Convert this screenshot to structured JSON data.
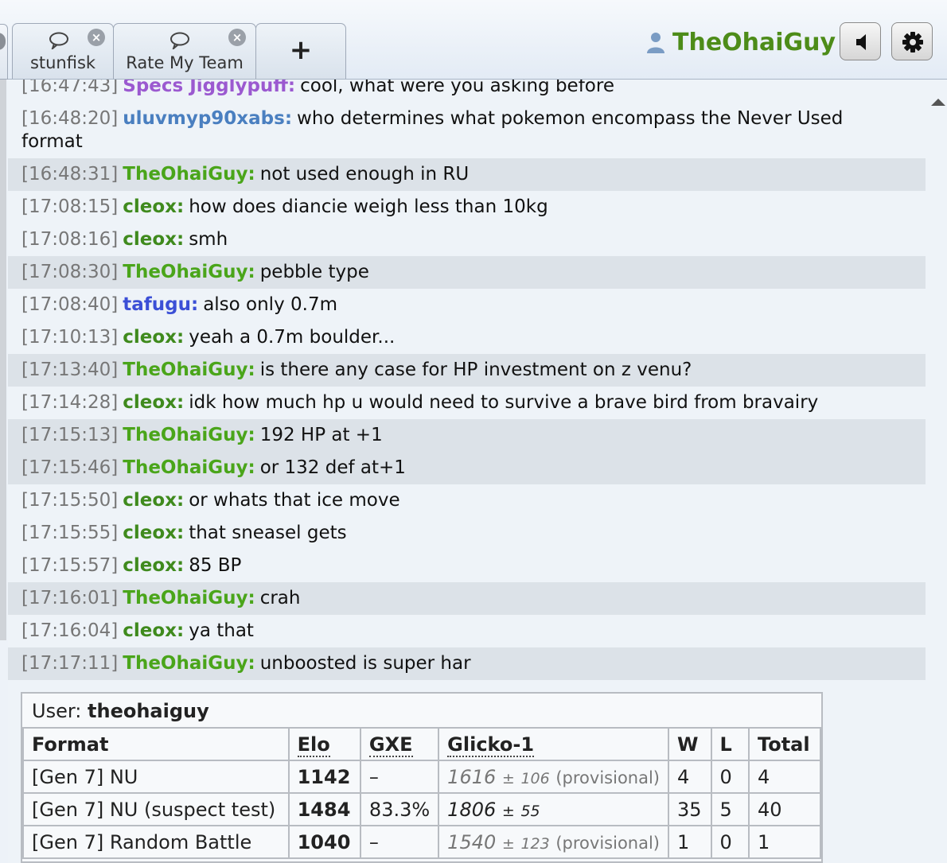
{
  "header": {
    "tabs": [
      {
        "label": "stunfisk"
      },
      {
        "label": "Rate My Team"
      }
    ],
    "add_label": "+",
    "username": "TheOhaiGuy",
    "colors": {
      "username": "#4d8c19"
    }
  },
  "chat": {
    "messages": [
      {
        "time": "[16:47:43]",
        "user": "Specs Jigglypuff:",
        "text": "cool, what were you asking before",
        "color": "#9b59d0",
        "hl": false
      },
      {
        "time": "[16:48:20]",
        "user": "uluvmyp90xabs:",
        "text": "who determines what pokemon encompass the Never Used format",
        "color": "#4a7fc0",
        "hl": false
      },
      {
        "time": "[16:48:31]",
        "user": "TheOhaiGuy:",
        "text": "not used enough in RU",
        "color": "#4aa51a",
        "hl": true
      },
      {
        "time": "[17:08:15]",
        "user": "cleox:",
        "text": "how does diancie weigh less than 10kg",
        "color": "#3f8a1d",
        "hl": false
      },
      {
        "time": "[17:08:16]",
        "user": "cleox:",
        "text": "smh",
        "color": "#3f8a1d",
        "hl": false
      },
      {
        "time": "[17:08:30]",
        "user": "TheOhaiGuy:",
        "text": "pebble type",
        "color": "#4aa51a",
        "hl": true
      },
      {
        "time": "[17:08:40]",
        "user": "tafugu:",
        "text": "also only 0.7m",
        "color": "#3b4fd6",
        "hl": false
      },
      {
        "time": "[17:10:13]",
        "user": "cleox:",
        "text": "yeah a 0.7m boulder...",
        "color": "#3f8a1d",
        "hl": false
      },
      {
        "time": "[17:13:40]",
        "user": "TheOhaiGuy:",
        "text": "is there any case for HP investment on z venu?",
        "color": "#4aa51a",
        "hl": true
      },
      {
        "time": "[17:14:28]",
        "user": "cleox:",
        "text": "idk how much hp u would need to survive a brave bird from bravairy",
        "color": "#3f8a1d",
        "hl": false
      },
      {
        "time": "[17:15:13]",
        "user": "TheOhaiGuy:",
        "text": "192 HP at +1",
        "color": "#4aa51a",
        "hl": true
      },
      {
        "time": "[17:15:46]",
        "user": "TheOhaiGuy:",
        "text": "or 132 def at+1",
        "color": "#4aa51a",
        "hl": true
      },
      {
        "time": "[17:15:50]",
        "user": "cleox:",
        "text": "or whats that ice move",
        "color": "#3f8a1d",
        "hl": false
      },
      {
        "time": "[17:15:55]",
        "user": "cleox:",
        "text": "that sneasel gets",
        "color": "#3f8a1d",
        "hl": false
      },
      {
        "time": "[17:15:57]",
        "user": "cleox:",
        "text": "85 BP",
        "color": "#3f8a1d",
        "hl": false
      },
      {
        "time": "[17:16:01]",
        "user": "TheOhaiGuy:",
        "text": "crah",
        "color": "#4aa51a",
        "hl": true
      },
      {
        "time": "[17:16:04]",
        "user": "cleox:",
        "text": "ya that",
        "color": "#3f8a1d",
        "hl": false
      },
      {
        "time": "[17:17:11]",
        "user": "TheOhaiGuy:",
        "text": "unboosted is super har",
        "color": "#4aa51a",
        "hl": true
      }
    ]
  },
  "rank": {
    "user_label": "User:",
    "user_value": "theohaiguy",
    "headers": {
      "format": "Format",
      "elo": "Elo",
      "gxe": "GXE",
      "glicko": "Glicko-1",
      "w": "W",
      "l": "L",
      "total": "Total"
    },
    "rows": [
      {
        "format": "[Gen 7] NU",
        "elo": "1142",
        "gxe": "–",
        "glicko": "1616",
        "pm": "±",
        "dev": "106",
        "tag": "(provisional)",
        "provisional": true,
        "w": "4",
        "l": "0",
        "total": "4"
      },
      {
        "format": "[Gen 7] NU (suspect test)",
        "elo": "1484",
        "gxe": "83.3%",
        "glicko": "1806",
        "pm": "±",
        "dev": "55",
        "tag": "",
        "provisional": false,
        "w": "35",
        "l": "5",
        "total": "40"
      },
      {
        "format": "[Gen 7] Random Battle",
        "elo": "1040",
        "gxe": "–",
        "glicko": "1540",
        "pm": "±",
        "dev": "123",
        "tag": "(provisional)",
        "provisional": true,
        "w": "1",
        "l": "0",
        "total": "1"
      }
    ]
  }
}
